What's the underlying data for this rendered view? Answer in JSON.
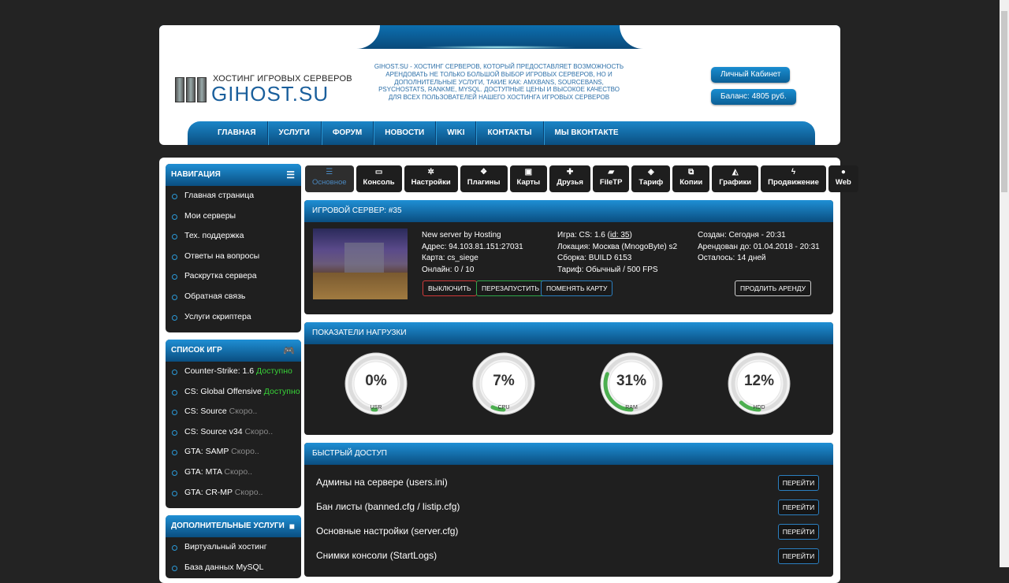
{
  "header": {
    "logo_sub": "ХОСТИНГ ИГРОВЫХ СЕРВЕРОВ",
    "logo_main": "GIHOST.SU",
    "tagline": "GIHOST.SU - ХОСТИНГ СЕРВЕРОВ, КОТОРЫЙ ПРЕДОСТАВЛЯЕТ ВОЗМОЖНОСТЬ АРЕНДОВАТЬ НЕ ТОЛЬКО БОЛЬШОЙ ВЫБОР ИГРОВЫХ СЕРВЕРОВ, НО И ДОПОЛНИТЕЛЬНЫЕ УСЛУГИ, ТАКИЕ КАК: AMXBANS, SOURCEBANS, PSYCHOSTATS, RANKME, MYSQL. ДОСТУПНЫЕ ЦЕНЫ И ВЫСОКОЕ КАЧЕСТВО ДЛЯ ВСЕХ ПОЛЬЗОВАТЕЛЕЙ НАШЕГО ХОСТИНГА ИГРОВЫХ СЕРВЕРОВ",
    "cabinet_label": "Личный Кабинет",
    "balance_label": "Баланс: 4805 руб.",
    "nav": [
      "ГЛАВНАЯ",
      "УСЛУГИ",
      "ФОРУМ",
      "НОВОСТИ",
      "WIKI",
      "КОНТАКТЫ",
      "МЫ ВКОНТАКТЕ"
    ]
  },
  "sidebar": {
    "navigation": {
      "title": "НАВИГАЦИЯ",
      "items": [
        "Главная страница",
        "Мои серверы",
        "Тех. поддержка",
        "Ответы на вопросы",
        "Раскрутка сервера",
        "Обратная связь",
        "Услуги скриптера"
      ]
    },
    "games": {
      "title": "СПИСОК ИГР",
      "items": [
        {
          "name": "Counter-Strike: 1.6",
          "status": "Доступно"
        },
        {
          "name": "CS: Global Offensive",
          "status": "Доступно"
        },
        {
          "name": "CS: Source",
          "status": "Скоро.."
        },
        {
          "name": "CS: Source v34",
          "status": "Скоро.."
        },
        {
          "name": "GTA: SAMP",
          "status": "Скоро.."
        },
        {
          "name": "GTA: MTA",
          "status": "Скоро.."
        },
        {
          "name": "GTA: CR-MP",
          "status": "Скоро.."
        }
      ]
    },
    "extra": {
      "title": "ДОПОЛНИТЕЛЬНЫЕ УСЛУГИ",
      "items": [
        "Виртуальный хостинг",
        "База данных MySQL"
      ]
    }
  },
  "tabs": [
    {
      "label": "Основное",
      "icon": "list-icon",
      "active": true
    },
    {
      "label": "Консоль",
      "icon": "monitor-icon"
    },
    {
      "label": "Настройки",
      "icon": "gear-icon"
    },
    {
      "label": "Плагины",
      "icon": "cubes-icon"
    },
    {
      "label": "Карты",
      "icon": "image-icon"
    },
    {
      "label": "Друзья",
      "icon": "user-plus-icon"
    },
    {
      "label": "FileTP",
      "icon": "folder-open-icon"
    },
    {
      "label": "Тариф",
      "icon": "dropbox-icon"
    },
    {
      "label": "Копии",
      "icon": "copy-icon"
    },
    {
      "label": "Графики",
      "icon": "area-chart-icon"
    },
    {
      "label": "Продвижение",
      "icon": "bolt-icon"
    },
    {
      "label": "Web",
      "icon": "globe-icon"
    }
  ],
  "server": {
    "title": "ИГРОВОЙ СЕРВЕР: #35",
    "name": "New server by Hosting",
    "address": "Адрес: 94.103.81.151:27031",
    "map": "Карта: cs_siege",
    "online": "Онлайн: 0 / 10",
    "game_prefix": "Игра: CS: 1.6 (",
    "game_id": "id: 35",
    "game_suffix": ")",
    "location": "Локация: Москва (MnogoByte) s2",
    "build": "Сборка: BUILD 6153",
    "tariff": "Тариф: Обычный / 500 FPS",
    "created": "Создан: Сегодня - 20:31",
    "rented_until": "Арендован до: 01.04.2018 - 20:31",
    "remaining": "Осталось: 14 дней",
    "btn_off": "ВЫКЛЮЧИТЬ",
    "btn_restart": "ПЕРЕЗАПУСТИТЬ",
    "btn_map": "ПОМЕНЯТЬ КАРТУ",
    "btn_extend": "ПРОДЛИТЬ АРЕНДУ"
  },
  "load": {
    "title": "ПОКАЗАТЕЛИ НАГРУЗКИ",
    "gauges": [
      {
        "label": "USR",
        "value": "0%",
        "percent": 0
      },
      {
        "label": "CPU",
        "value": "7%",
        "percent": 7
      },
      {
        "label": "RAM",
        "value": "31%",
        "percent": 31
      },
      {
        "label": "HDD",
        "value": "12%",
        "percent": 12
      }
    ]
  },
  "quick": {
    "title": "БЫСТРЫЙ ДОСТУП",
    "go_label": "ПЕРЕЙТИ",
    "items": [
      "Админы на сервере (users.ini)",
      "Бан листы (banned.cfg / listip.cfg)",
      "Основные настройки (server.cfg)",
      "Снимки консоли (StartLogs)"
    ]
  },
  "colors": {
    "accent": "#1a8dd0",
    "available": "#38d238",
    "soon": "#8a8a8a",
    "gauge": "#4caf50"
  }
}
